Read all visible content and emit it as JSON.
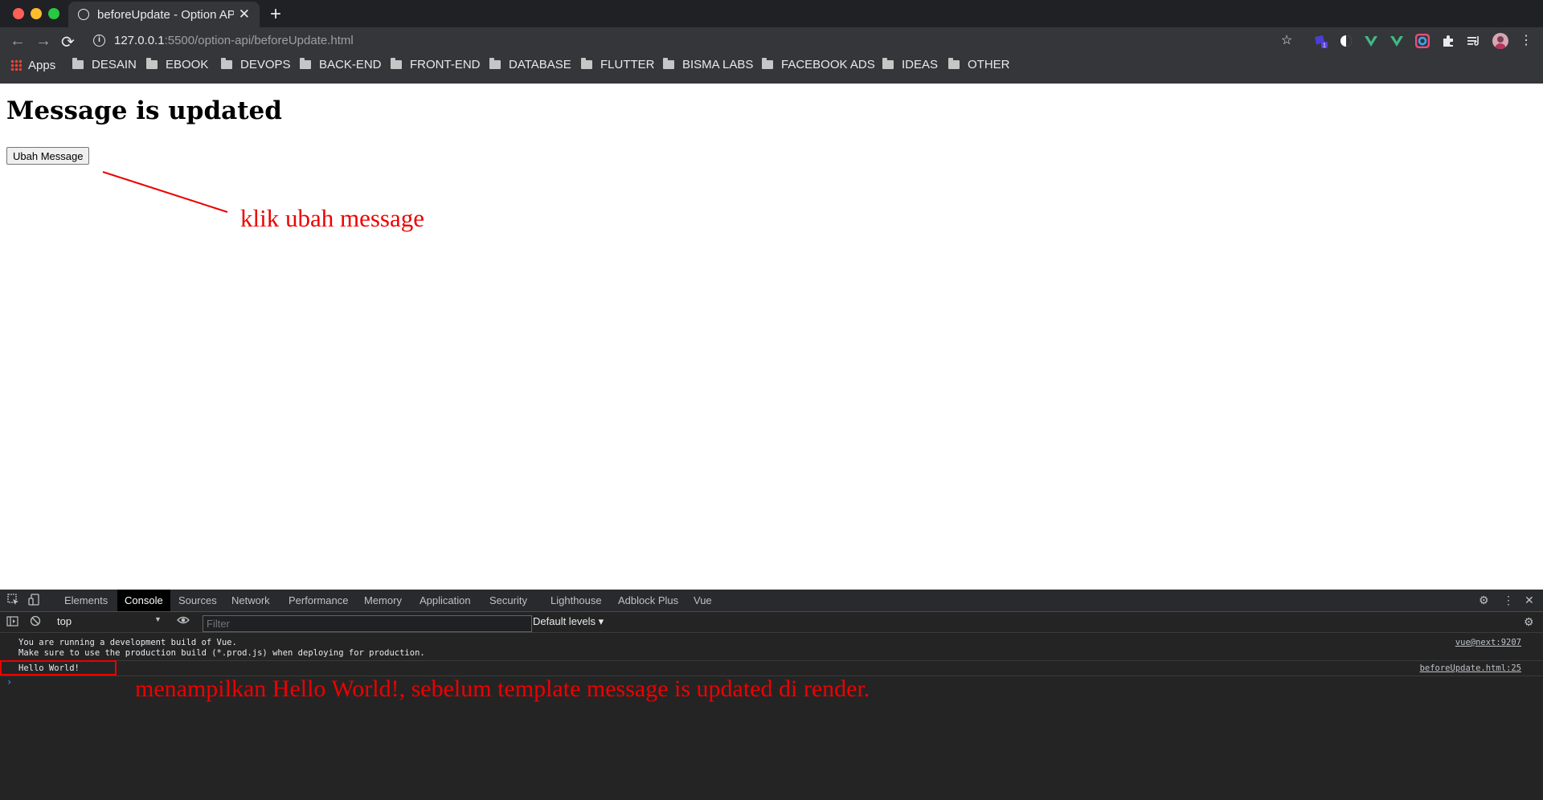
{
  "browser": {
    "tab": {
      "title": "beforeUpdate - Option API",
      "close": "✕"
    },
    "new_tab": "+",
    "nav": {
      "back": "←",
      "forward": "→",
      "reload": "⟳"
    },
    "url": {
      "host": "127.0.0.1",
      "path": ":5500/option-api/beforeUpdate.html"
    },
    "bookmarks": [
      "Apps",
      "DESAIN",
      "EBOOK",
      "DEVOPS",
      "BACK-END",
      "FRONT-END",
      "DATABASE",
      "FLUTTER",
      "BISMA LABS",
      "FACEBOOK ADS",
      "IDEAS",
      "OTHER"
    ],
    "extension_badge": "1"
  },
  "page": {
    "heading": "Message is updated",
    "button_label": "Ubah Message"
  },
  "annotations": {
    "button_note": "klik  ubah  message",
    "console_note": "menampilkan  Hello  World!,  sebelum  template  message  is  updated  di  render."
  },
  "devtools": {
    "tabs": [
      "Elements",
      "Console",
      "Sources",
      "Network",
      "Performance",
      "Memory",
      "Application",
      "Security",
      "Lighthouse",
      "Adblock Plus",
      "Vue"
    ],
    "active_tab": "Console",
    "context": "top",
    "filter_placeholder": "Filter",
    "levels": "Default levels ▾",
    "console": [
      {
        "message": "You are running a development build of Vue.\nMake sure to use the production build (*.prod.js) when deploying for production.",
        "source": "vue@next:9207"
      },
      {
        "message": "Hello World!",
        "source": "beforeUpdate.html:25"
      }
    ],
    "prompt": "›"
  },
  "colors": {
    "annotation": "#ee0000",
    "chrome_bg": "#35363a",
    "devtools_bg": "#242424"
  }
}
